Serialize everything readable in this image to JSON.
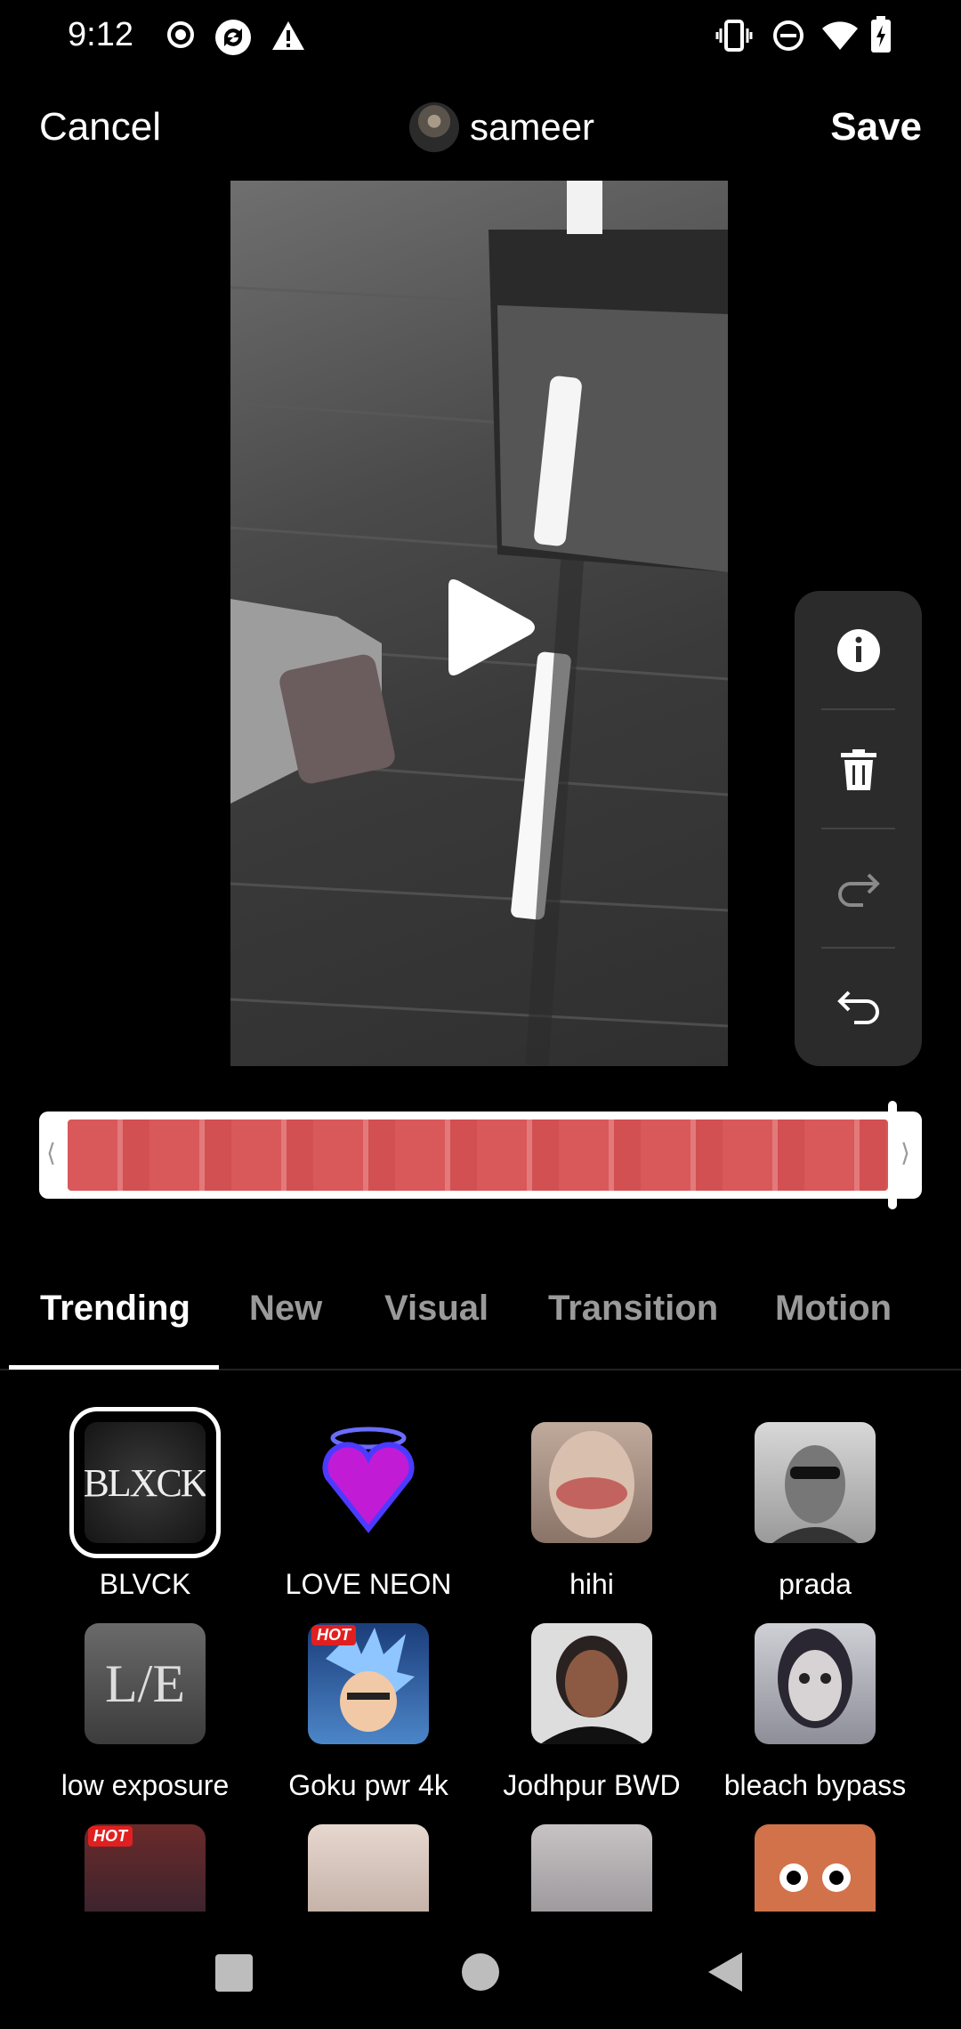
{
  "status_bar": {
    "time": "9:12",
    "icons_left": [
      "record-icon",
      "sync-icon",
      "warning-icon"
    ],
    "icons_right": [
      "vibrate-icon",
      "do-not-disturb-icon",
      "wifi-icon",
      "battery-icon"
    ]
  },
  "header": {
    "cancel_label": "Cancel",
    "username": "sameer",
    "save_label": "Save"
  },
  "side_toolbar": [
    "info-icon",
    "trash-icon",
    "redo-icon",
    "undo-icon"
  ],
  "tabs": [
    {
      "label": "Trending",
      "active": true
    },
    {
      "label": "New",
      "active": false
    },
    {
      "label": "Visual",
      "active": false
    },
    {
      "label": "Transition",
      "active": false
    },
    {
      "label": "Motion",
      "active": false
    }
  ],
  "effects": [
    {
      "label": "BLVCK",
      "thumb_text": "BLXCK",
      "selected": true,
      "hot": false
    },
    {
      "label": "LOVE NEON",
      "selected": false,
      "hot": false
    },
    {
      "label": "hihi",
      "selected": false,
      "hot": false
    },
    {
      "label": "prada",
      "selected": false,
      "hot": false
    },
    {
      "label": "low exposure",
      "thumb_text": "L/E",
      "selected": false,
      "hot": false
    },
    {
      "label": "Goku pwr 4k",
      "selected": false,
      "hot": true
    },
    {
      "label": "Jodhpur BWD",
      "selected": false,
      "hot": false
    },
    {
      "label": "bleach bypass",
      "selected": false,
      "hot": false
    },
    {
      "label": "",
      "selected": false,
      "hot": true
    },
    {
      "label": "",
      "selected": false,
      "hot": false
    },
    {
      "label": "",
      "selected": false,
      "hot": false
    },
    {
      "label": "",
      "selected": false,
      "hot": false
    }
  ],
  "hot_badge": "HOT",
  "colors": {
    "background": "#000000",
    "timeline_strip": "#d9585a",
    "toolbar_bg": "#2b2b2b"
  }
}
